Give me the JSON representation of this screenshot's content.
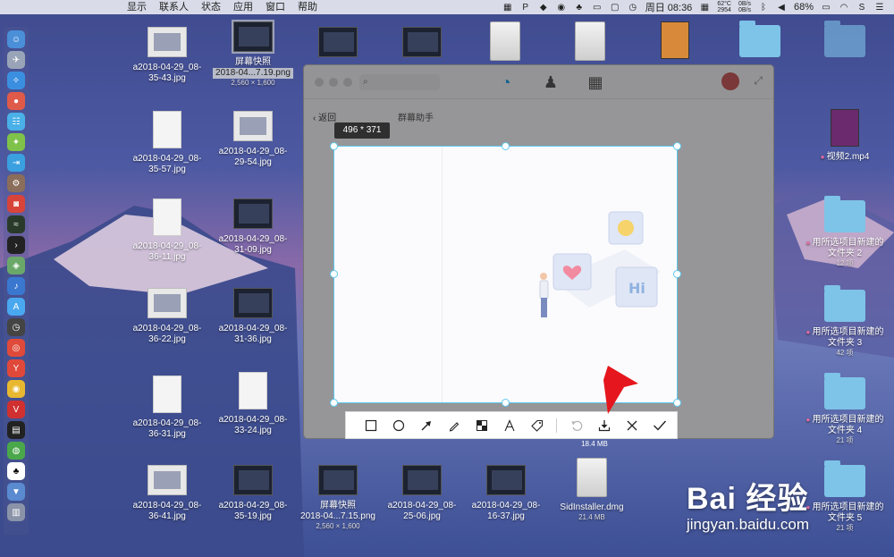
{
  "menubar": {
    "menus": [
      "显示",
      "联系人",
      "状态",
      "应用",
      "窗口",
      "帮助"
    ],
    "clock": "周日 08:36",
    "cpu_temp": "62°C",
    "cpu_speed": "2954",
    "net_up": "0B/s",
    "net_down": "0B/s",
    "battery": "68%"
  },
  "desktop": {
    "items": [
      {
        "name": "a2018-04-29_08-35-43.jpg",
        "kind": "shot"
      },
      {
        "name": "屏幕快照",
        "name2": "2018-04...7.19.png",
        "meta": "2,560 × 1,600",
        "kind": "dark"
      },
      {
        "name": "a2018-04-29_08-35-57.jpg",
        "kind": "doc"
      },
      {
        "name": "a2018-04-29_08-29-54.jpg",
        "kind": "shot"
      },
      {
        "name": "a2018-04-29_08-36-11.jpg",
        "kind": "doc"
      },
      {
        "name": "a2018-04-29_08-31-09.jpg",
        "kind": "dark"
      },
      {
        "name": "a2018-04-29_08-36-22.jpg",
        "kind": "shot"
      },
      {
        "name": "a2018-04-29_08-31-36.jpg",
        "kind": "dark"
      },
      {
        "name": "a2018-04-29_08-36-31.jpg",
        "kind": "doc"
      },
      {
        "name": "a2018-04-29_08-33-24.jpg",
        "kind": "doc"
      },
      {
        "name": "a2018-04-29_08-36-41.jpg",
        "kind": "shot"
      },
      {
        "name": "a2018-04-29_08-35-19.jpg",
        "kind": "dark"
      },
      {
        "name": "屏幕快照",
        "name2": "2018-04...7.15.png",
        "meta": "2,560 × 1,600",
        "kind": "dark"
      },
      {
        "name": "a2018-04-29_08-25-06.jpg",
        "kind": "dark"
      },
      {
        "name": "a2018-04-29_08-16-37.jpg",
        "kind": "dark"
      },
      {
        "name": "SidInstaller.dmg",
        "meta": "21.4 MB",
        "kind": "dmg"
      },
      {
        "name": "视频2.mp4",
        "kind": "video"
      },
      {
        "name": "用所选项目新建的文件夹 2",
        "meta": "12 项",
        "kind": "folder"
      },
      {
        "name": "用所选项目新建的文件夹 3",
        "meta": "42 项",
        "kind": "folder"
      },
      {
        "name": "用所选项目新建的文件夹 4",
        "meta": "21 项",
        "kind": "folder"
      },
      {
        "name": "用所选项目新建的文件夹 5",
        "meta": "21 项",
        "kind": "folder"
      }
    ],
    "partial_labels": {
      "dl_size": "18.4 MB"
    }
  },
  "chat_window": {
    "search_placeholder": "",
    "back_label": "返回",
    "group_title": "群幕助手"
  },
  "capture": {
    "size_label": "496 * 371"
  },
  "toolbar": {
    "tools": [
      "rectangle-tool",
      "ellipse-tool",
      "arrow-tool",
      "pen-tool",
      "mosaic-tool",
      "text-tool",
      "tag-tool",
      "undo-tool",
      "download-tool",
      "cancel-tool",
      "confirm-tool"
    ]
  },
  "watermark": {
    "logo": "Bai 经验",
    "url": "jingyan.baidu.com"
  },
  "colors": {
    "selection_border": "#5ec8ee",
    "red_arrow": "#e5161d",
    "qq_blue": "#1fa1e6"
  }
}
